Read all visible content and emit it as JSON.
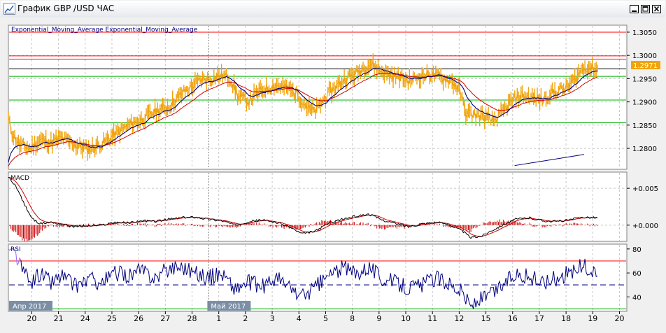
{
  "window": {
    "title": "График GBP /USD ЧАС",
    "icons": [
      "chart-app-icon",
      "minimize-icon",
      "maximize-icon",
      "close-icon"
    ]
  },
  "chart_data": [
    {
      "name": "price",
      "type": "line",
      "indicators_label": "Exponential_Moving_Average Exponential_Moving_Average",
      "y_ticks": [
        "1.3050",
        "1.3000",
        "1.2950",
        "1.2900",
        "1.2850",
        "1.2800"
      ],
      "ylim": [
        1.2755,
        1.3065
      ],
      "last_price": "1.2971",
      "horizontal_levels": [
        {
          "value": 1.305,
          "color": "#ff0000"
        },
        {
          "value": 1.2999,
          "color": "#ff0000"
        },
        {
          "value": 1.2992,
          "color": "#ff0000"
        },
        {
          "value": 1.2971,
          "color": "#000000"
        },
        {
          "value": 1.2955,
          "color": "#00b000"
        },
        {
          "value": 1.2904,
          "color": "#00b000"
        },
        {
          "value": 1.2855,
          "color": "#00b000"
        }
      ],
      "trendline": {
        "from": {
          "day": 18.95,
          "value": 1.2763
        },
        "to": {
          "day": 21.55,
          "value": 1.2787
        },
        "color": "#000080"
      },
      "series_colors": {
        "price": "#f0a30a",
        "ema_fast": "#000080",
        "ema_slow": "#d00000"
      },
      "price_anchors": [
        [
          0.0,
          1.2862
        ],
        [
          0.15,
          1.2832
        ],
        [
          0.4,
          1.2808
        ],
        [
          0.8,
          1.28
        ],
        [
          1.2,
          1.2818
        ],
        [
          1.6,
          1.2812
        ],
        [
          2.0,
          1.2822
        ],
        [
          2.5,
          1.2808
        ],
        [
          3.0,
          1.2798
        ],
        [
          3.5,
          1.281
        ],
        [
          4.0,
          1.283
        ],
        [
          4.5,
          1.285
        ],
        [
          5.0,
          1.2862
        ],
        [
          5.5,
          1.288
        ],
        [
          6.0,
          1.289
        ],
        [
          6.5,
          1.2918
        ],
        [
          6.8,
          1.293
        ],
        [
          7.2,
          1.2948
        ],
        [
          7.6,
          1.295
        ],
        [
          8.0,
          1.2958
        ],
        [
          8.3,
          1.295
        ],
        [
          8.6,
          1.2912
        ],
        [
          9.0,
          1.2902
        ],
        [
          9.3,
          1.2918
        ],
        [
          9.6,
          1.2928
        ],
        [
          10.0,
          1.2936
        ],
        [
          10.4,
          1.293
        ],
        [
          10.8,
          1.2918
        ],
        [
          11.0,
          1.2902
        ],
        [
          11.3,
          1.2882
        ],
        [
          11.5,
          1.288
        ],
        [
          11.8,
          1.2905
        ],
        [
          12.2,
          1.293
        ],
        [
          12.6,
          1.295
        ],
        [
          13.0,
          1.296
        ],
        [
          13.3,
          1.2975
        ],
        [
          13.6,
          1.2982
        ],
        [
          13.9,
          1.2968
        ],
        [
          14.3,
          1.2958
        ],
        [
          14.7,
          1.2952
        ],
        [
          15.0,
          1.2945
        ],
        [
          15.4,
          1.2955
        ],
        [
          15.8,
          1.296
        ],
        [
          16.2,
          1.2952
        ],
        [
          16.6,
          1.2945
        ],
        [
          16.9,
          1.2925
        ],
        [
          17.1,
          1.2878
        ],
        [
          17.4,
          1.2872
        ],
        [
          17.8,
          1.2868
        ],
        [
          18.1,
          1.2858
        ],
        [
          18.4,
          1.287
        ],
        [
          18.8,
          1.29
        ],
        [
          19.2,
          1.2915
        ],
        [
          19.6,
          1.2908
        ],
        [
          20.0,
          1.2905
        ],
        [
          20.3,
          1.2918
        ],
        [
          20.6,
          1.2925
        ],
        [
          20.9,
          1.293
        ],
        [
          21.2,
          1.2948
        ],
        [
          21.4,
          1.2965
        ],
        [
          21.6,
          1.2975
        ],
        [
          21.9,
          1.2972
        ],
        [
          22.05,
          1.2971
        ]
      ]
    },
    {
      "name": "macd",
      "type": "line",
      "label": "MACD",
      "y_ticks": [
        "+0.005",
        "+0.000"
      ],
      "ylim": [
        -0.0022,
        0.0072
      ],
      "zero_line": 0.0,
      "series_colors": {
        "macd": "#000000",
        "signal": "#d00000",
        "histogram": "#cc0000"
      },
      "macd_anchors": [
        [
          0.0,
          0.0065
        ],
        [
          0.3,
          0.0052
        ],
        [
          0.6,
          0.0028
        ],
        [
          0.9,
          0.0008
        ],
        [
          1.2,
          0.0002
        ],
        [
          1.6,
          0.0004
        ],
        [
          2.0,
          0.0001
        ],
        [
          2.5,
          -0.0002
        ],
        [
          3.0,
          -0.0001
        ],
        [
          3.5,
          0.0
        ],
        [
          4.0,
          0.0004
        ],
        [
          4.5,
          0.0003
        ],
        [
          5.0,
          0.0006
        ],
        [
          5.5,
          0.0005
        ],
        [
          6.0,
          0.0008
        ],
        [
          6.5,
          0.001
        ],
        [
          7.0,
          0.0011
        ],
        [
          7.5,
          0.0008
        ],
        [
          8.0,
          0.0006
        ],
        [
          8.5,
          0.0
        ],
        [
          9.0,
          0.0005
        ],
        [
          9.5,
          0.0007
        ],
        [
          10.0,
          0.0004
        ],
        [
          10.5,
          -0.0002
        ],
        [
          11.0,
          -0.0012
        ],
        [
          11.5,
          -0.0008
        ],
        [
          12.0,
          0.0003
        ],
        [
          12.5,
          0.0008
        ],
        [
          13.0,
          0.0012
        ],
        [
          13.5,
          0.0015
        ],
        [
          14.0,
          0.0007
        ],
        [
          14.5,
          0.0002
        ],
        [
          15.0,
          -0.0002
        ],
        [
          15.5,
          0.0002
        ],
        [
          16.0,
          0.0004
        ],
        [
          16.5,
          0.0001
        ],
        [
          17.0,
          -0.0008
        ],
        [
          17.3,
          -0.0017
        ],
        [
          17.7,
          -0.0015
        ],
        [
          18.1,
          -0.0007
        ],
        [
          18.6,
          0.0002
        ],
        [
          19.0,
          0.0008
        ],
        [
          19.5,
          0.001
        ],
        [
          20.0,
          0.0006
        ],
        [
          20.5,
          0.0005
        ],
        [
          21.0,
          0.0007
        ],
        [
          21.5,
          0.0011
        ],
        [
          22.05,
          0.001
        ]
      ]
    },
    {
      "name": "rsi",
      "type": "line",
      "label": "RSI",
      "y_ticks": [
        "80",
        "60",
        "40"
      ],
      "ylim": [
        28,
        84
      ],
      "levels": [
        {
          "value": 70,
          "color": "#ff0000",
          "style": "solid"
        },
        {
          "value": 50,
          "color": "#000080",
          "style": "dashed"
        },
        {
          "value": 30,
          "color": "#00b000",
          "style": "solid"
        }
      ],
      "series_colors": {
        "rsi": "#000080",
        "rsi_start": "#9966ff"
      },
      "rsi_anchors": [
        [
          0.0,
          80
        ],
        [
          0.2,
          79
        ],
        [
          0.45,
          66
        ],
        [
          0.8,
          51
        ],
        [
          1.2,
          60
        ],
        [
          1.6,
          52
        ],
        [
          2.0,
          58
        ],
        [
          2.5,
          49
        ],
        [
          3.0,
          55
        ],
        [
          3.5,
          52
        ],
        [
          4.0,
          60
        ],
        [
          4.5,
          58
        ],
        [
          5.0,
          62
        ],
        [
          5.5,
          56
        ],
        [
          6.0,
          64
        ],
        [
          6.5,
          66
        ],
        [
          7.0,
          60
        ],
        [
          7.5,
          56
        ],
        [
          8.0,
          60
        ],
        [
          8.5,
          46
        ],
        [
          9.0,
          52
        ],
        [
          9.5,
          48
        ],
        [
          10.0,
          56
        ],
        [
          10.5,
          48
        ],
        [
          11.0,
          40
        ],
        [
          11.5,
          48
        ],
        [
          12.0,
          58
        ],
        [
          12.5,
          64
        ],
        [
          13.0,
          60
        ],
        [
          13.5,
          66
        ],
        [
          14.0,
          55
        ],
        [
          14.5,
          52
        ],
        [
          15.0,
          48
        ],
        [
          15.5,
          50
        ],
        [
          16.0,
          56
        ],
        [
          16.5,
          52
        ],
        [
          17.0,
          44
        ],
        [
          17.3,
          32
        ],
        [
          17.7,
          38
        ],
        [
          18.1,
          42
        ],
        [
          18.6,
          52
        ],
        [
          19.0,
          60
        ],
        [
          19.5,
          56
        ],
        [
          20.0,
          52
        ],
        [
          20.5,
          56
        ],
        [
          21.0,
          60
        ],
        [
          21.5,
          66
        ],
        [
          22.05,
          58
        ]
      ]
    }
  ],
  "x_axis": {
    "ticks": [
      {
        "day": 0.875,
        "label": "20"
      },
      {
        "day": 1.875,
        "label": "21"
      },
      {
        "day": 2.875,
        "label": "24"
      },
      {
        "day": 3.875,
        "label": "25"
      },
      {
        "day": 4.875,
        "label": "26"
      },
      {
        "day": 5.875,
        "label": "27"
      },
      {
        "day": 6.875,
        "label": "28"
      },
      {
        "day": 7.875,
        "label": "1"
      },
      {
        "day": 8.875,
        "label": "2"
      },
      {
        "day": 9.875,
        "label": "3"
      },
      {
        "day": 10.875,
        "label": "4"
      },
      {
        "day": 11.875,
        "label": "5"
      },
      {
        "day": 12.875,
        "label": "8"
      },
      {
        "day": 13.875,
        "label": "9"
      },
      {
        "day": 14.875,
        "label": "10"
      },
      {
        "day": 15.875,
        "label": "11"
      },
      {
        "day": 16.875,
        "label": "12"
      },
      {
        "day": 17.875,
        "label": "15"
      },
      {
        "day": 18.875,
        "label": "16"
      },
      {
        "day": 19.875,
        "label": "17"
      },
      {
        "day": 20.875,
        "label": "18"
      },
      {
        "day": 21.875,
        "label": "19"
      },
      {
        "day": 22.875,
        "label": "20"
      }
    ],
    "month_labels": [
      {
        "day": 0.0,
        "label": "Апр 2017"
      },
      {
        "day": 7.5,
        "label": "Май 2017"
      }
    ],
    "range_days": [
      0,
      23.15
    ],
    "data_end_day": 22.05
  }
}
